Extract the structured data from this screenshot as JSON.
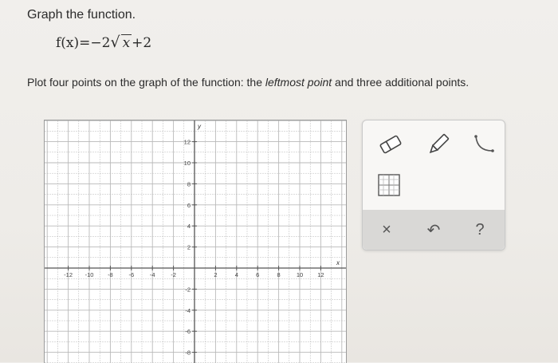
{
  "header": {
    "title": "Graph the function.",
    "formula": {
      "lhs": "f(x)=",
      "coef": "−2",
      "radicand": "x",
      "tail": "+2"
    },
    "instruction": {
      "before": "Plot four points on the graph of the function: the ",
      "emphasis": "leftmost point",
      "after": " and three additional points."
    }
  },
  "graph": {
    "x_axis_label": "x",
    "y_axis_label": "y",
    "x_ticks": [
      "-12",
      "-10",
      "-8",
      "-6",
      "-4",
      "-2",
      "2",
      "4",
      "6",
      "8",
      "10",
      "12"
    ],
    "y_ticks": [
      "12",
      "10",
      "8",
      "6",
      "4",
      "2",
      "-2",
      "-4",
      "-6",
      "-8"
    ]
  },
  "tools": {
    "eraser_icon": "eraser-icon",
    "pencil_icon": "pencil-icon",
    "curve_icon": "curve-tool-icon",
    "table_icon": "table-grid-icon",
    "clear_label": "×",
    "undo_label": "↶",
    "help_label": "?"
  },
  "colors": {
    "grid": "#b9b9b9",
    "axis": "#555555",
    "panel_bar": "#d9d8d6"
  }
}
